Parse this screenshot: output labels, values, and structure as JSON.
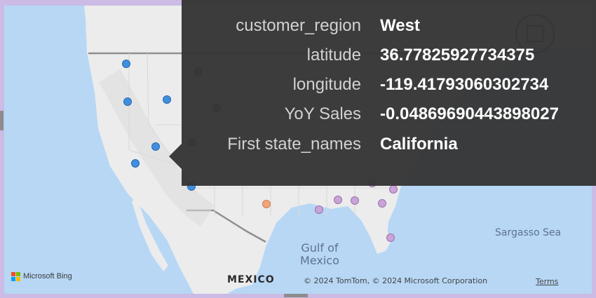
{
  "tooltip": {
    "rows": [
      {
        "label": "customer_region",
        "value": "West"
      },
      {
        "label": "latitude",
        "value": "36.77825927734375"
      },
      {
        "label": "longitude",
        "value": "-119.41793060302734"
      },
      {
        "label": "YoY Sales",
        "value": "-0.04869690443898027"
      },
      {
        "label": "First state_names",
        "value": "California"
      }
    ]
  },
  "map": {
    "labels": {
      "sargasso": "Sargasso Sea",
      "gulf_line1": "Gulf of",
      "gulf_line2": "Mexico",
      "mexico": "MEXICO",
      "credit": "© 2024 TomTom, © 2024 Microsoft Corporation",
      "terms": "Terms"
    },
    "branding": "Microsoft Bing",
    "icons": {
      "logo": "microsoft-logo-icon",
      "focus": "focus-mode-icon"
    }
  },
  "colors": {
    "tooltip_bg": "#343434",
    "west_dot": "#3f8fe0",
    "other_dot": "#c9a4d6",
    "orange_dot": "#f2a57a",
    "water": "#b7d7f5"
  }
}
